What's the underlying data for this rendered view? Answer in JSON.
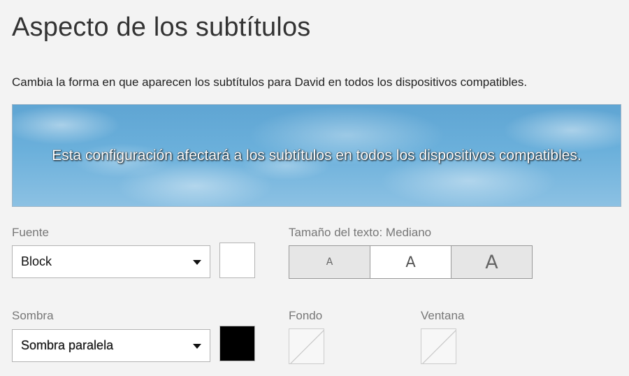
{
  "page": {
    "title": "Aspecto de los subtítulos",
    "description": "Cambia la forma en que aparecen los subtítulos para David en todos los dispositivos compatibles."
  },
  "preview": {
    "text": "Esta configuración afectará a los subtítulos en todos los dispositivos compatibles."
  },
  "font": {
    "label": "Fuente",
    "selected": "Block",
    "color": "#ffffff"
  },
  "text_size": {
    "label": "Tamaño del texto: Mediano",
    "options": [
      "A",
      "A",
      "A"
    ],
    "selected_index": 1
  },
  "shadow": {
    "label": "Sombra",
    "selected": "Sombra paralela",
    "color": "#000000"
  },
  "background": {
    "label": "Fondo"
  },
  "window": {
    "label": "Ventana"
  },
  "colors": {
    "page_bg": "#f3f3f3",
    "preview_sky": "#6bb0db"
  }
}
